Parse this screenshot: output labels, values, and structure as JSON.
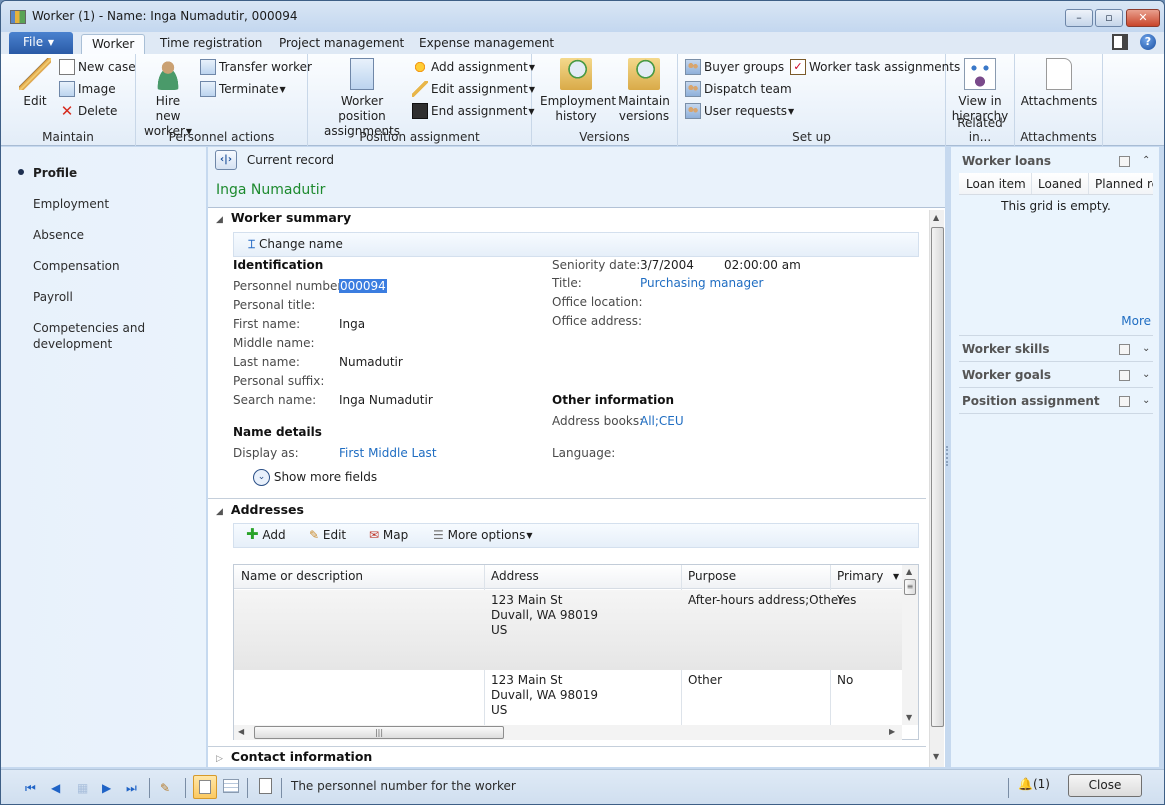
{
  "window": {
    "title": "Worker (1) - Name: Inga Numadutir, 000094",
    "controls": {
      "minimize": "–",
      "maximize": "▫",
      "close": "✕"
    }
  },
  "ribbon": {
    "file_tab": "File",
    "tabs": [
      {
        "label": "Worker",
        "active": true
      },
      {
        "label": "Time registration",
        "active": false
      },
      {
        "label": "Project management",
        "active": false
      },
      {
        "label": "Expense management",
        "active": false
      }
    ],
    "groups": {
      "maintain": {
        "label": "Maintain",
        "edit": "Edit",
        "new_case": "New case",
        "image": "Image",
        "delete": "Delete"
      },
      "personnel_actions": {
        "label": "Personnel actions",
        "hire_line1": "Hire new",
        "hire_line2": "worker",
        "transfer": "Transfer worker",
        "terminate": "Terminate"
      },
      "position_assignment": {
        "label": "Position assignment",
        "wpa_line1": "Worker position",
        "wpa_line2": "assignments",
        "add": "Add assignment",
        "edit": "Edit assignment",
        "end": "End assignment"
      },
      "versions": {
        "label": "Versions",
        "emp_line1": "Employment",
        "emp_line2": "history",
        "maint_line1": "Maintain",
        "maint_line2": "versions"
      },
      "setup": {
        "label": "Set up",
        "buyer_groups": "Buyer groups",
        "dispatch_team": "Dispatch team",
        "user_requests": "User requests",
        "worker_task": "Worker task assignments"
      },
      "related": {
        "label": "Related in...",
        "view_line1": "View in",
        "view_line2": "hierarchy"
      },
      "attachments": {
        "label": "Attachments",
        "button": "Attachments"
      }
    }
  },
  "left_nav": {
    "items": [
      {
        "label": "Profile",
        "active": true
      },
      {
        "label": "Employment"
      },
      {
        "label": "Absence"
      },
      {
        "label": "Compensation"
      },
      {
        "label": "Payroll"
      },
      {
        "label": "Competencies and"
      },
      {
        "label": "development"
      }
    ]
  },
  "record": {
    "current_record_label": "Current record",
    "name": "Inga Numadutir"
  },
  "worker_summary": {
    "header": "Worker summary",
    "change_name": "Change name",
    "identification": {
      "header": "Identification",
      "personnel_number_label": "Personnel number:",
      "personnel_number": "000094",
      "personal_title_label": "Personal title:",
      "first_name_label": "First name:",
      "first_name": "Inga",
      "middle_name_label": "Middle name:",
      "last_name_label": "Last name:",
      "last_name": "Numadutir",
      "personal_suffix_label": "Personal suffix:",
      "search_name_label": "Search name:",
      "search_name": "Inga Numadutir"
    },
    "name_details": {
      "header": "Name details",
      "display_as_label": "Display as:",
      "display_as": "First Middle Last"
    },
    "show_more": "Show more fields",
    "employment": {
      "seniority_label": "Seniority date:",
      "seniority_date": "3/7/2004",
      "seniority_time": "02:00:00 am",
      "title_label": "Title:",
      "title": "Purchasing manager",
      "office_location_label": "Office location:",
      "office_address_label": "Office address:"
    },
    "other": {
      "header": "Other information",
      "address_books_label": "Address books:",
      "address_books": "All;CEU",
      "language_label": "Language:"
    }
  },
  "addresses": {
    "header": "Addresses",
    "actions": {
      "add": "Add",
      "edit": "Edit",
      "map": "Map",
      "more": "More options"
    },
    "columns": [
      "Name or description",
      "Address",
      "Purpose",
      "Primary"
    ],
    "rows": [
      {
        "name": "",
        "address": [
          "123 Main St",
          "Duvall, WA 98019",
          "US"
        ],
        "purpose": "After-hours address;Other",
        "primary": "Yes"
      },
      {
        "name": "",
        "address": [
          "123 Main St",
          "Duvall, WA 98019",
          "US"
        ],
        "purpose": "Other",
        "primary": "No"
      }
    ]
  },
  "contact_information": {
    "header": "Contact information"
  },
  "right_pane": {
    "worker_loans": {
      "title": "Worker loans",
      "columns": [
        "Loan item",
        "Loaned",
        "Planned re"
      ],
      "empty_text": "This grid is empty.",
      "more": "More"
    },
    "worker_skills": "Worker skills",
    "worker_goals": "Worker goals",
    "position_assignment": "Position assignment"
  },
  "status_bar": {
    "message": "The personnel number for the worker",
    "alerts": "(1)",
    "close": "Close"
  },
  "colors": {
    "link": "#1f6dc2",
    "record_name": "#1d8a2e",
    "selection": "#3b7de0"
  }
}
